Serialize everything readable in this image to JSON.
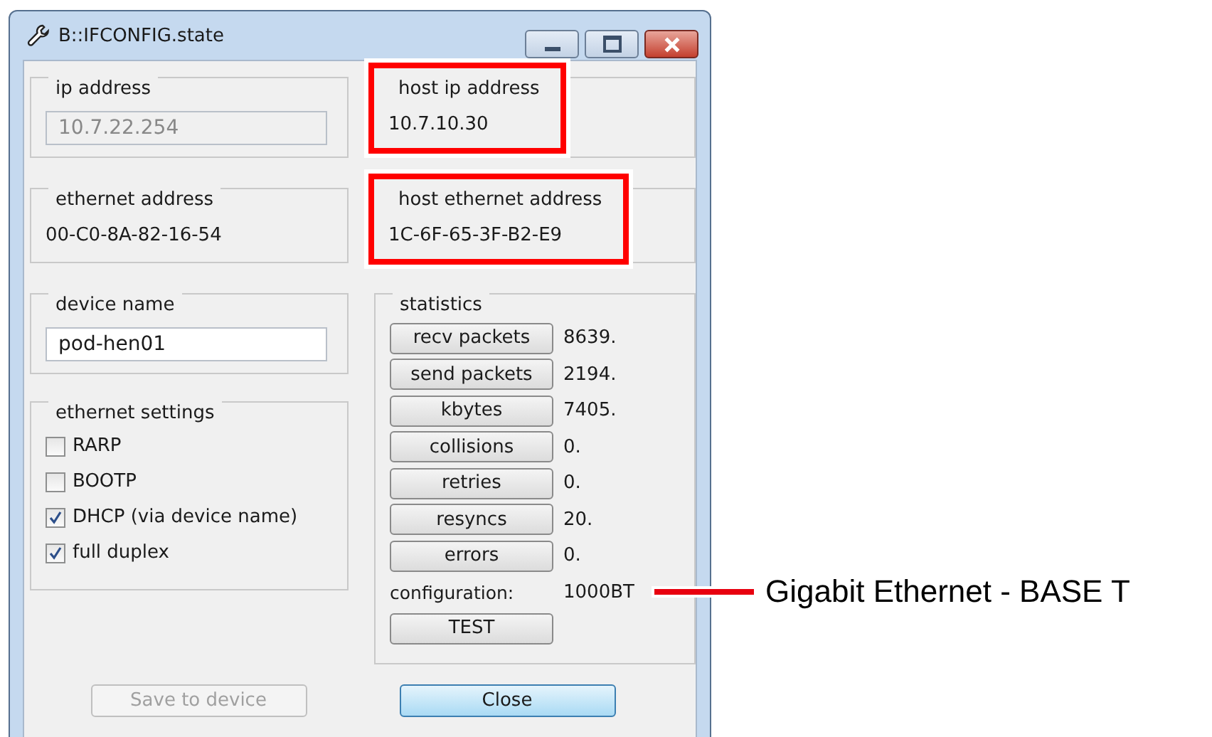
{
  "window": {
    "title": "B::IFCONFIG.state"
  },
  "address_groups": [
    {
      "label": "ip address",
      "value": "10.7.22.254",
      "kind": "field",
      "highlighted": false
    },
    {
      "label": "host ip address",
      "value": "10.7.10.30",
      "kind": "text",
      "highlighted": true
    },
    {
      "label": "ethernet address",
      "value": "00-C0-8A-82-16-54",
      "kind": "text",
      "highlighted": false
    },
    {
      "label": "host ethernet address",
      "value": "1C-6F-65-3F-B2-E9",
      "kind": "text",
      "highlighted": true
    }
  ],
  "device_name": {
    "label": "device name",
    "value": "pod-hen01"
  },
  "ethernet_settings": {
    "label": "ethernet settings",
    "options": [
      {
        "label": "RARP",
        "checked": false
      },
      {
        "label": "BOOTP",
        "checked": false
      },
      {
        "label": "DHCP (via device name)",
        "checked": true
      },
      {
        "label": "full duplex",
        "checked": true
      }
    ]
  },
  "statistics": {
    "label": "statistics",
    "counters": [
      {
        "label": "recv packets",
        "value": "8639."
      },
      {
        "label": "send packets",
        "value": "2194."
      },
      {
        "label": "kbytes",
        "value": "7405."
      },
      {
        "label": "collisions",
        "value": "0."
      },
      {
        "label": "retries",
        "value": "0."
      },
      {
        "label": "resyncs",
        "value": "20."
      },
      {
        "label": "errors",
        "value": "0."
      }
    ],
    "configuration": {
      "label": "configuration:",
      "value": "1000BT"
    },
    "test_button": "TEST"
  },
  "buttons": [
    {
      "label": "Save to device",
      "disabled": true,
      "default": false
    },
    {
      "label": "Close",
      "disabled": false,
      "default": true
    }
  ],
  "annotation": {
    "text": "Gigabit Ethernet - BASE T"
  }
}
